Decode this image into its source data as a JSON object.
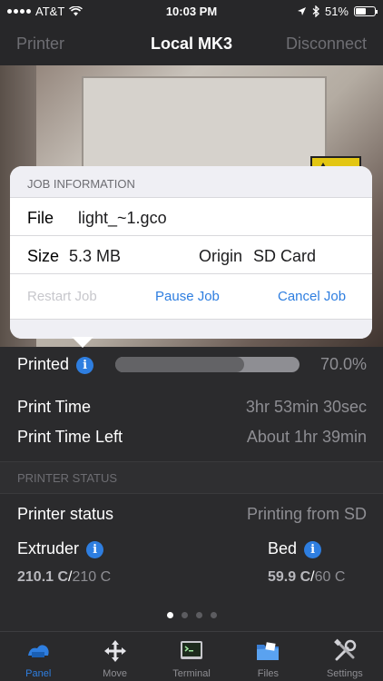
{
  "status_bar": {
    "carrier": "AT&T",
    "time": "10:03 PM",
    "battery": "51%"
  },
  "navbar": {
    "left": "Printer",
    "title": "Local MK3",
    "right": "Disconnect"
  },
  "job_popover": {
    "header": "JOB INFORMATION",
    "file_label": "File",
    "file_value": "light_~1.gco",
    "size_label": "Size",
    "size_value": "5.3 MB",
    "origin_label": "Origin",
    "origin_value": "SD Card",
    "restart": "Restart Job",
    "pause": "Pause Job",
    "cancel": "Cancel Job"
  },
  "progress": {
    "label": "Printed",
    "fraction": 0.7,
    "percent_text": "70.0%"
  },
  "print_time": {
    "label": "Print Time",
    "value": "3hr 53min 30sec"
  },
  "print_time_left": {
    "label": "Print Time Left",
    "value": "About 1hr 39min"
  },
  "printer_status_section": "PRINTER STATUS",
  "printer_status": {
    "label": "Printer status",
    "value": "Printing from SD"
  },
  "extruder": {
    "label": "Extruder",
    "actual": "210.1 C",
    "sep": "/",
    "target": "210 C"
  },
  "bed": {
    "label": "Bed",
    "actual": "59.9 C",
    "sep": "/",
    "target": "60 C"
  },
  "page_dots": 4,
  "tabs": [
    {
      "label": "Panel",
      "icon": "printer-icon"
    },
    {
      "label": "Move",
      "icon": "move-arrows-icon"
    },
    {
      "label": "Terminal",
      "icon": "terminal-icon"
    },
    {
      "label": "Files",
      "icon": "folder-icon"
    },
    {
      "label": "Settings",
      "icon": "tools-icon"
    }
  ],
  "colors": {
    "accent": "#2e7ee0",
    "background": "#2b2b2d",
    "secondary_text": "#8e8e93"
  }
}
